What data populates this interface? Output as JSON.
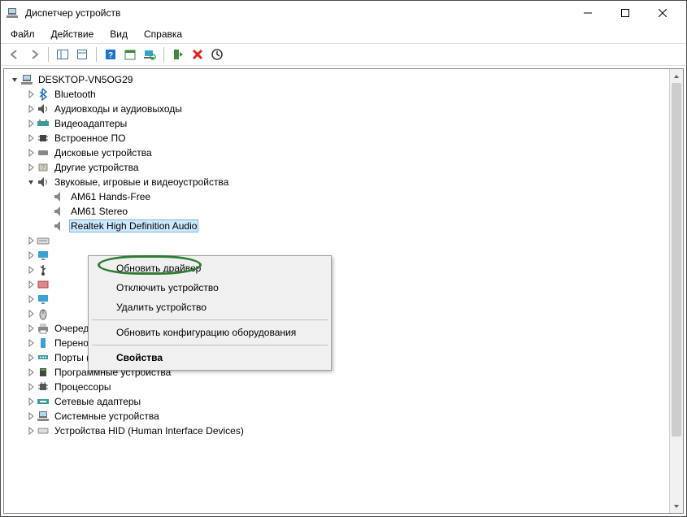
{
  "title": "Диспетчер устройств",
  "menu": {
    "file": "Файл",
    "action": "Действие",
    "view": "Вид",
    "help": "Справка"
  },
  "root": "DESKTOP-VN5OG29",
  "cats": {
    "bluetooth": "Bluetooth",
    "audio_io": "Аудиовходы и аудиовыходы",
    "video": "Видеоадаптеры",
    "firmware": "Встроенное ПО",
    "disk": "Дисковые устройства",
    "other": "Другие устройства",
    "sound": "Звуковые, игровые и видеоустройства",
    "print_q": "Очереди печати",
    "portable": "Переносные устройства",
    "ports": "Порты (COM и LPT)",
    "software": "Программные устройства",
    "cpu": "Процессоры",
    "net": "Сетевые адаптеры",
    "system": "Системные устройства",
    "hid": "Устройства HID (Human Interface Devices)"
  },
  "devs": {
    "am61_hf": "AM61 Hands-Free",
    "am61_st": "AM61 Stereo",
    "realtek": "Realtek High Definition Audio"
  },
  "ctx": {
    "update": "Обновить драйвер",
    "disable": "Отключить устройство",
    "remove": "Удалить устройство",
    "rescan": "Обновить конфигурацию оборудования",
    "props": "Свойства"
  }
}
